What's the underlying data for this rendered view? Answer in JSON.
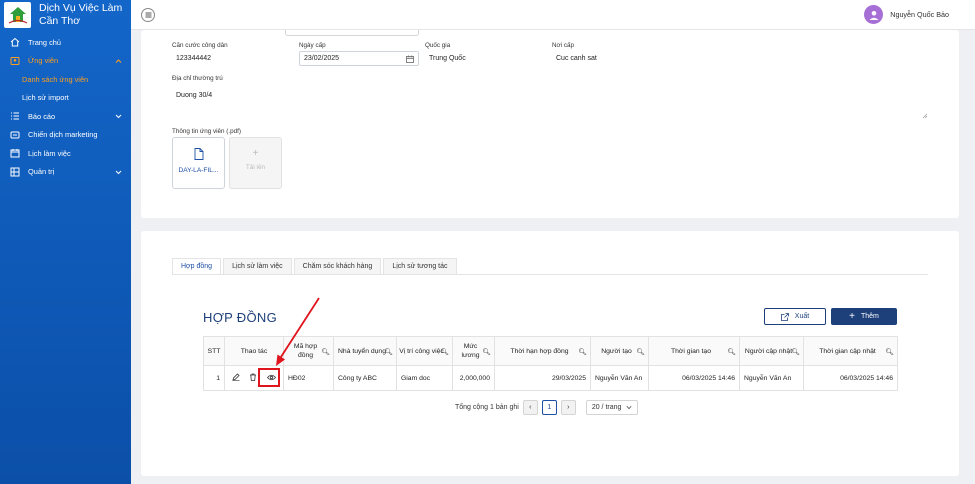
{
  "app": {
    "brand_line1": "Dịch Vụ Việc Làm",
    "brand_line2": "Cần Thơ"
  },
  "sidebar": {
    "items": [
      {
        "label": "Trang chủ",
        "icon": "home-icon"
      },
      {
        "label": "Ứng viên",
        "icon": "user-icon"
      },
      {
        "label": "Danh sách ứng viên"
      },
      {
        "label": "Lịch sử import"
      },
      {
        "label": "Báo cáo",
        "icon": "list-icon"
      },
      {
        "label": "Chiến dịch marketing",
        "icon": "campaign-icon"
      },
      {
        "label": "Lịch làm việc",
        "icon": "calendar-icon"
      },
      {
        "label": "Quản trị",
        "icon": "admin-icon"
      }
    ]
  },
  "header": {
    "user_name": "Nguyễn Quốc Bảo"
  },
  "profile": {
    "id_label": "Căn cước công dân",
    "id_value": "123344442",
    "issue_date_label": "Ngày cấp",
    "issue_date_value": "23/02/2025",
    "nationality_label": "Quốc gia",
    "nationality_value": "Trung Quốc",
    "issue_place_label": "Nơi cấp",
    "issue_place_value": "Cuc canh sat",
    "address_label": "Địa chỉ thường trú",
    "address_value": "Duong 30/4",
    "file_label": "Thông tin ứng viên (.pdf)",
    "file_name": "DAY-LA-FIL...",
    "upload_label": "Tải lên"
  },
  "tabs": [
    "Hợp đồng",
    "Lịch sử làm việc",
    "Chăm sóc khách hàng",
    "Lịch sử tương tác"
  ],
  "contracts": {
    "title": "HỢP ĐỒNG",
    "export_label": "Xuất",
    "add_label": "Thêm",
    "columns": [
      "STT",
      "Thao tác",
      "Mã hợp đồng",
      "Nhà tuyển dụng",
      "Vị trí công việc",
      "Mức lương",
      "Thời hạn hợp đồng",
      "Người tạo",
      "Thời gian tạo",
      "Người cập nhật",
      "Thời gian cập nhật"
    ],
    "rows": [
      {
        "stt": "1",
        "code": "HĐ02",
        "employer": "Công ty ABC",
        "position": "Giam doc",
        "salary": "2,000,000",
        "term": "29/03/2025",
        "creator": "Nguyễn Văn An",
        "created_at": "06/03/2025 14:46",
        "updater": "Nguyễn Văn An",
        "updated_at": "06/03/2025 14:46"
      }
    ],
    "total_text": "Tổng cộng 1 bản ghi",
    "current_page": "1",
    "page_size": "20 / trang"
  },
  "colors": {
    "sidebar": "#0b5cbf",
    "accent_orange": "#ff9f1c",
    "primary": "#1d3f7a",
    "highlight_red": "#e0141c"
  }
}
